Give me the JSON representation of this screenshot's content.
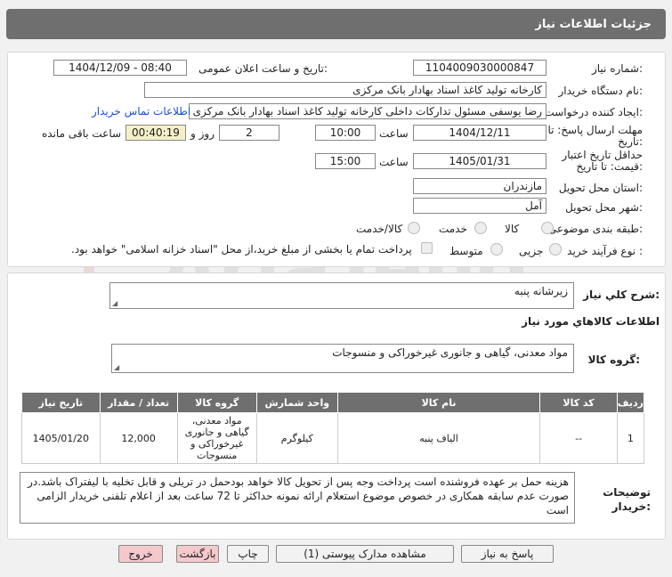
{
  "header": {
    "title": "جزئیات اطلاعات نیاز"
  },
  "labels": {
    "need_number": "شماره نیاز:",
    "announce_datetime": "تاریخ و ساعت اعلان عمومی:",
    "buyer_org": "نام دستگاه خریدار:",
    "creator": "ایجاد کننده درخواست:",
    "contact_link": "اطلاعات تماس خریدار",
    "deadline": "مهلت ارسال پاسخ: تا تاریخ:",
    "time": "ساعت",
    "day_and": "روز و",
    "remaining": "ساعت باقی مانده",
    "validity": "حداقل تاریخ اعتبار قیمت: تا تاریخ:",
    "province": "استان محل تحویل:",
    "city": "شهر محل تحویل:",
    "category": "طبقه بندی موضوعی:",
    "process": "نوع فرآیند خرید :",
    "summary": "شرح كلي نياز:",
    "goods_info": "اطلاعات كالاهاي مورد نياز",
    "goods_group": "گروه کالا:",
    "buyer_notes": "توضیحات خریدار:"
  },
  "values": {
    "need_number": "1104009030000847",
    "announce_datetime": "1404/12/09 - 08:40",
    "buyer_org": "کارخانه تولید کاغذ اسناد بهادار بانک مرکزی",
    "creator": "رضا یوسفی مسئول تدارکات داخلی کارخانه تولید کاغذ اسناد بهادار بانک مرکزی",
    "deadline_date": "1404/12/11",
    "deadline_time": "10:00",
    "days": "2",
    "remaining_time": "00:40:19",
    "validity_date": "1405/01/31",
    "validity_time": "15:00",
    "province": "مازندران",
    "city": "آمل",
    "summary": "زیرشانه پنبه",
    "goods_group": "مواد معدنی، گیاهی و جانوری غیرخوراکی و منسوجات",
    "buyer_notes": "هزینه حمل بر عهده فروشنده است پرداخت وجه پس از تحویل کالا خواهد بودحمل در تریلی و قابل تخلیه با لیفتراک باشد.در صورت عدم سابقه همکاری در خصوص موضوع استعلام ارائه نمونه حداکثر تا 72 ساعت بعد از اعلام تلفنی خریدار الزامی است"
  },
  "category_options": {
    "goods": "کالا",
    "service": "خدمت",
    "goods_service": "کالا/خدمت"
  },
  "process_options": {
    "partial": "جزیی",
    "medium": "متوسط",
    "treasury_note": "پرداخت تمام یا بخشی از مبلغ خرید،از محل \"اسناد خزانه اسلامی\" خواهد بود."
  },
  "table": {
    "headers": [
      "ردیف",
      "کد کالا",
      "نام کالا",
      "واحد شمارش",
      "گروه کالا",
      "تعداد / مقدار",
      "تاریخ نیاز"
    ],
    "rows": [
      [
        "1",
        "--",
        "الیاف پنبه",
        "کیلوگرم",
        "مواد معدنی، گیاهی و جانوری غیرخوراکی و منسوجات",
        "12,000",
        "1405/01/20"
      ]
    ]
  },
  "buttons": {
    "reply": "پاسخ به نیاز",
    "attachments": "مشاهده مدارک پیوستی (1)",
    "print": "چاپ",
    "back": "بازگشت",
    "exit": "خروج"
  },
  "watermark": "AriaTender.neT"
}
